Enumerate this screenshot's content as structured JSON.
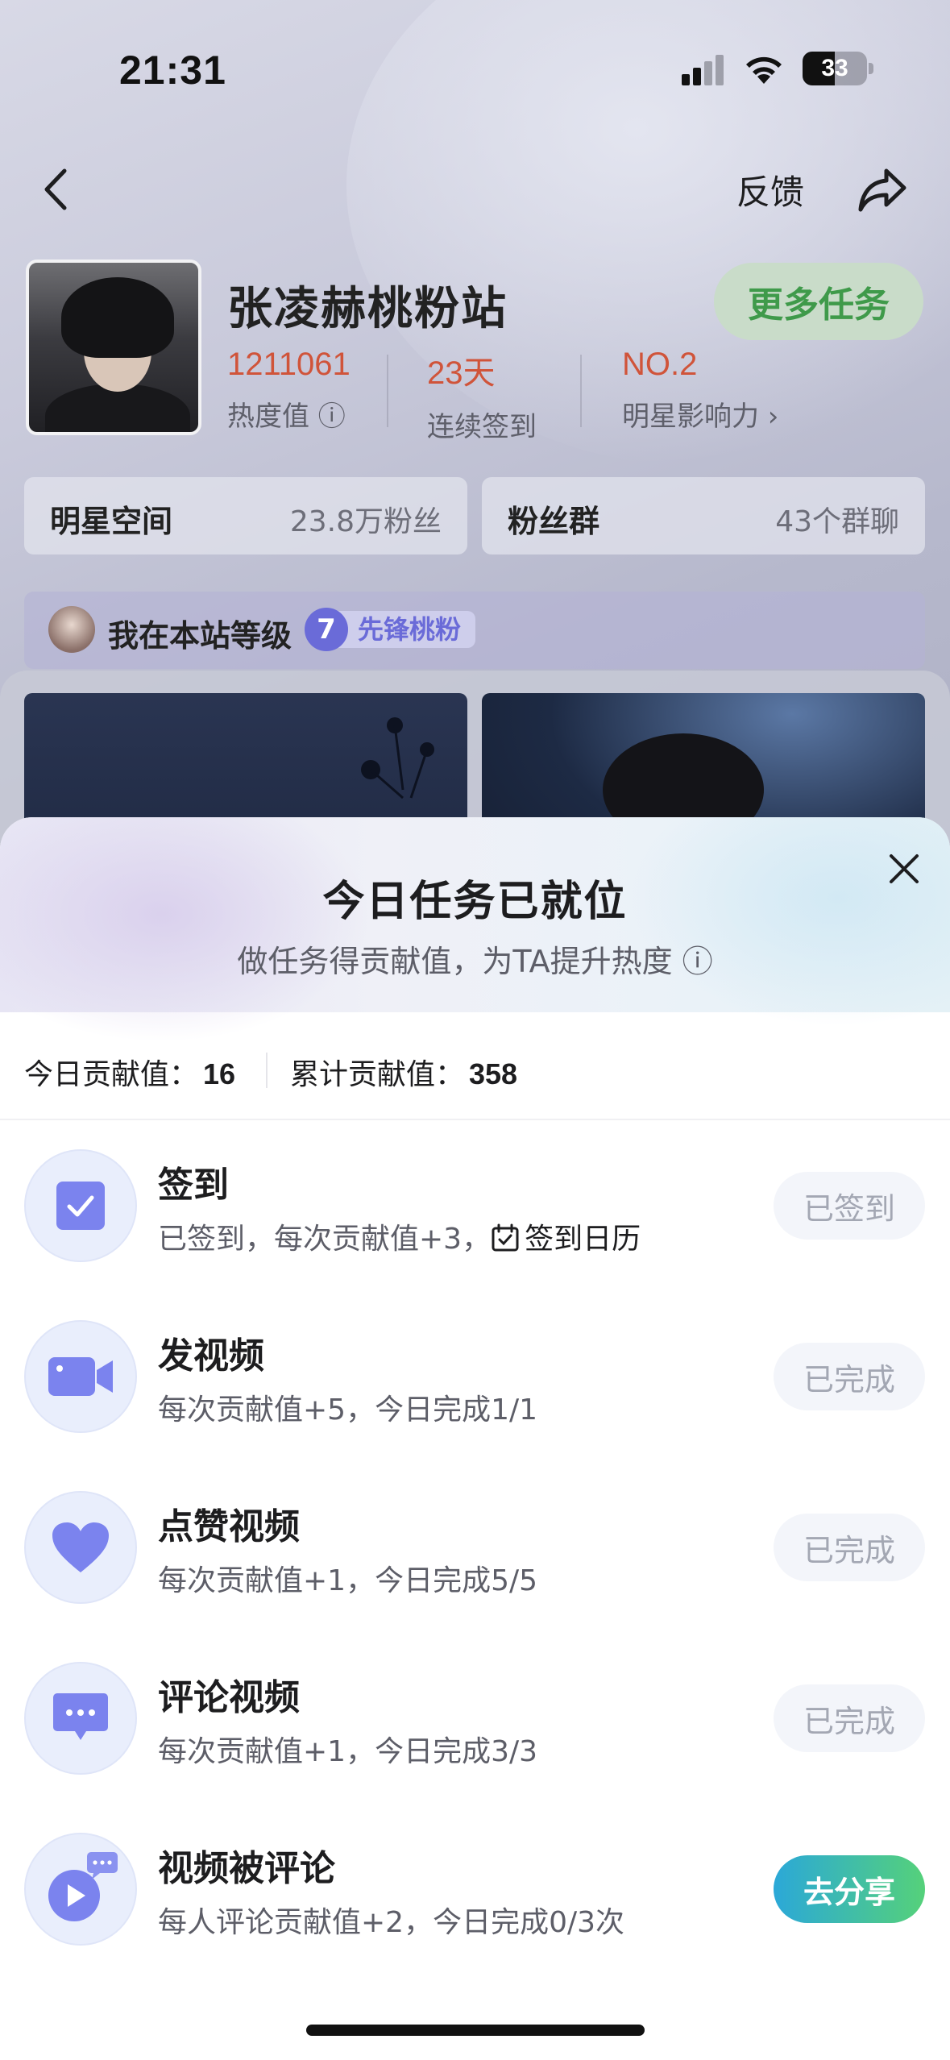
{
  "status_bar": {
    "time": "21:31",
    "battery": "33"
  },
  "nav": {
    "feedback": "反馈"
  },
  "profile": {
    "name": "张凌赫桃粉站",
    "more_tasks": "更多任务",
    "stats": [
      {
        "value": "1211061",
        "label": "热度值 ⓘ"
      },
      {
        "value": "23天",
        "label": "连续签到"
      },
      {
        "value": "NO.2",
        "label": "明星影响力 ›"
      }
    ]
  },
  "cards": {
    "space_title": "明星空间",
    "space_sub": "23.8万粉丝",
    "group_title": "粉丝群",
    "group_sub": "43个群聊"
  },
  "level": {
    "text": "我在本站等级",
    "num": "7",
    "name": "先锋桃粉"
  },
  "sheet": {
    "title": "今日任务已就位",
    "subtitle": "做任务得贡献值，为TA提升热度 ⓘ",
    "today_label": "今日贡献值：",
    "today_value": "16",
    "total_label": "累计贡献值：",
    "total_value": "358"
  },
  "tasks": [
    {
      "title": "签到",
      "desc": "已签到，每次贡献值+3，",
      "calendar": "签到日历",
      "button": "已签到",
      "icon": "checkbox-icon"
    },
    {
      "title": "发视频",
      "desc": "每次贡献值+5，今日完成1/1",
      "button": "已完成",
      "icon": "video-camera-icon"
    },
    {
      "title": "点赞视频",
      "desc": "每次贡献值+1，今日完成5/5",
      "button": "已完成",
      "icon": "heart-icon"
    },
    {
      "title": "评论视频",
      "desc": "每次贡献值+1，今日完成3/3",
      "button": "已完成",
      "icon": "comment-icon"
    },
    {
      "title": "视频被评论",
      "desc": "每人评论贡献值+2，今日完成0/3次",
      "button": "去分享",
      "icon": "play-comment-icon"
    }
  ],
  "colors": {
    "accent": "#6a6bd8",
    "stat_red": "#d0543a",
    "green": "#3f9a4a",
    "icon_purple": "#7b83ee"
  }
}
